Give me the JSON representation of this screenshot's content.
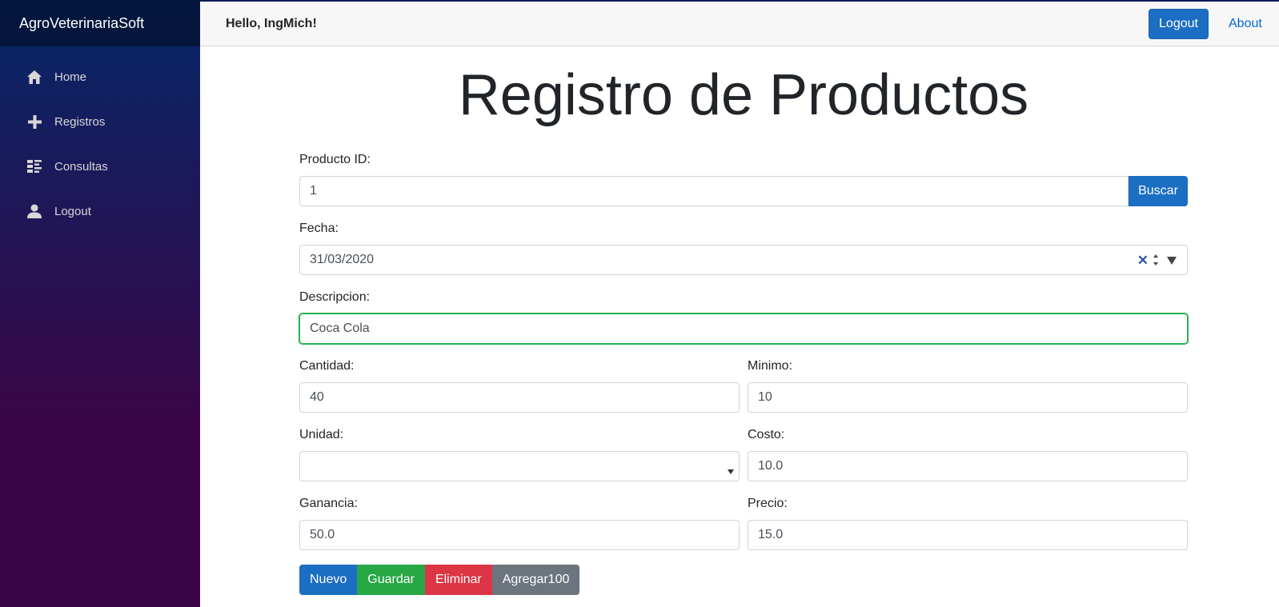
{
  "sidebar": {
    "brand": "AgroVeterinariaSoft",
    "items": [
      {
        "label": "Home",
        "icon": "home-icon"
      },
      {
        "label": "Registros",
        "icon": "plus-icon"
      },
      {
        "label": "Consultas",
        "icon": "list-icon"
      },
      {
        "label": "Logout",
        "icon": "person-icon"
      }
    ]
  },
  "header": {
    "greeting": "Hello, IngMich!",
    "logout_label": "Logout",
    "about_label": "About"
  },
  "form": {
    "title": "Registro de Productos",
    "producto_id": {
      "label": "Producto ID:",
      "value": "1",
      "button": "Buscar"
    },
    "fecha": {
      "label": "Fecha:",
      "value": "31/03/2020"
    },
    "descripcion": {
      "label": "Descripcion:",
      "value": "Coca Cola"
    },
    "cantidad": {
      "label": "Cantidad:",
      "value": "40"
    },
    "minimo": {
      "label": "Minimo:",
      "value": "10"
    },
    "unidad": {
      "label": "Unidad:",
      "value": ""
    },
    "costo": {
      "label": "Costo:",
      "value": "10.0"
    },
    "ganancia": {
      "label": "Ganancia:",
      "value": "50.0"
    },
    "precio": {
      "label": "Precio:",
      "value": "15.0"
    }
  },
  "actions": {
    "nuevo": "Nuevo",
    "guardar": "Guardar",
    "eliminar": "Eliminar",
    "agregar": "Agregar100"
  },
  "colors": {
    "primary": "#1b6ec2",
    "success": "#28a745",
    "danger": "#dc3545",
    "secondary": "#6c757d"
  }
}
